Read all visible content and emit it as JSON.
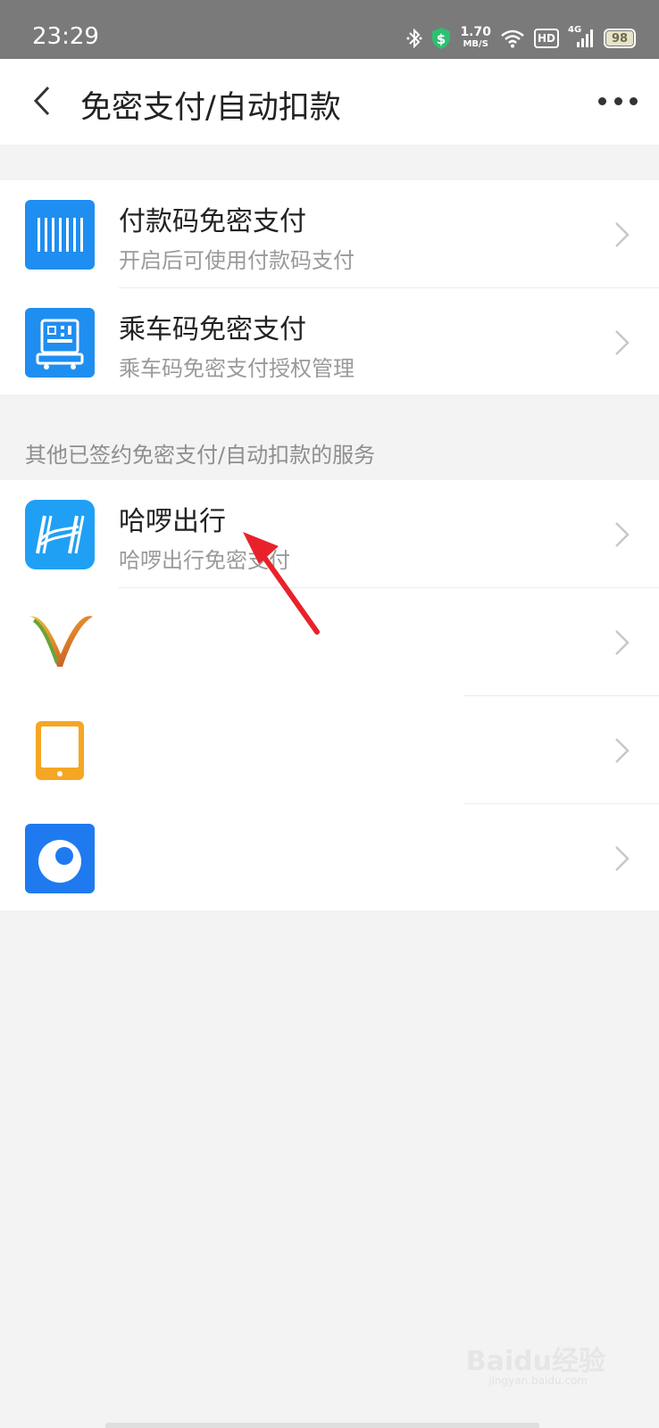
{
  "status_bar": {
    "time": "23:29",
    "speed_value": "1.70",
    "speed_unit": "MB/S",
    "hd_label": "HD",
    "network_label": "4G",
    "battery": "98",
    "icons": [
      "bluetooth-icon",
      "shield-dollar-icon",
      "wifi-icon",
      "hd-icon",
      "signal-icon",
      "battery-icon"
    ]
  },
  "navbar": {
    "title": "免密支付/自动扣款",
    "back_icon": "chevron-left-icon",
    "more_icon": "more-dots-icon"
  },
  "top_group": {
    "items": [
      {
        "title": "付款码免密支付",
        "subtitle": "开启后可使用付款码支付",
        "icon": "barcode-icon",
        "icon_color": "#1f8ef1"
      },
      {
        "title": "乘车码免密支付",
        "subtitle": "乘车码免密支付授权管理",
        "icon": "bus-qr-icon",
        "icon_color": "#1f8ef1"
      }
    ]
  },
  "section_label": "其他已签约免密支付/自动扣款的服务",
  "services": {
    "items": [
      {
        "title": "哈啰出行",
        "subtitle": "哈啰出行免密支付",
        "icon": "hello-logo-icon",
        "icon_color": "#1fa0f5"
      },
      {
        "title": "",
        "subtitle": "",
        "icon": "v-logo-icon",
        "icon_color": "#e0a12f"
      },
      {
        "title": "",
        "subtitle": "",
        "icon": "tablet-icon",
        "icon_color": "#f5a623"
      },
      {
        "title": "",
        "subtitle": "",
        "icon": "droplet-logo-icon",
        "icon_color": "#1f7af0"
      }
    ]
  },
  "annotation": {
    "arrow_color": "#e8222a"
  },
  "watermark": {
    "text": "Baidu经验",
    "sub": "jingyan.baidu.com"
  }
}
